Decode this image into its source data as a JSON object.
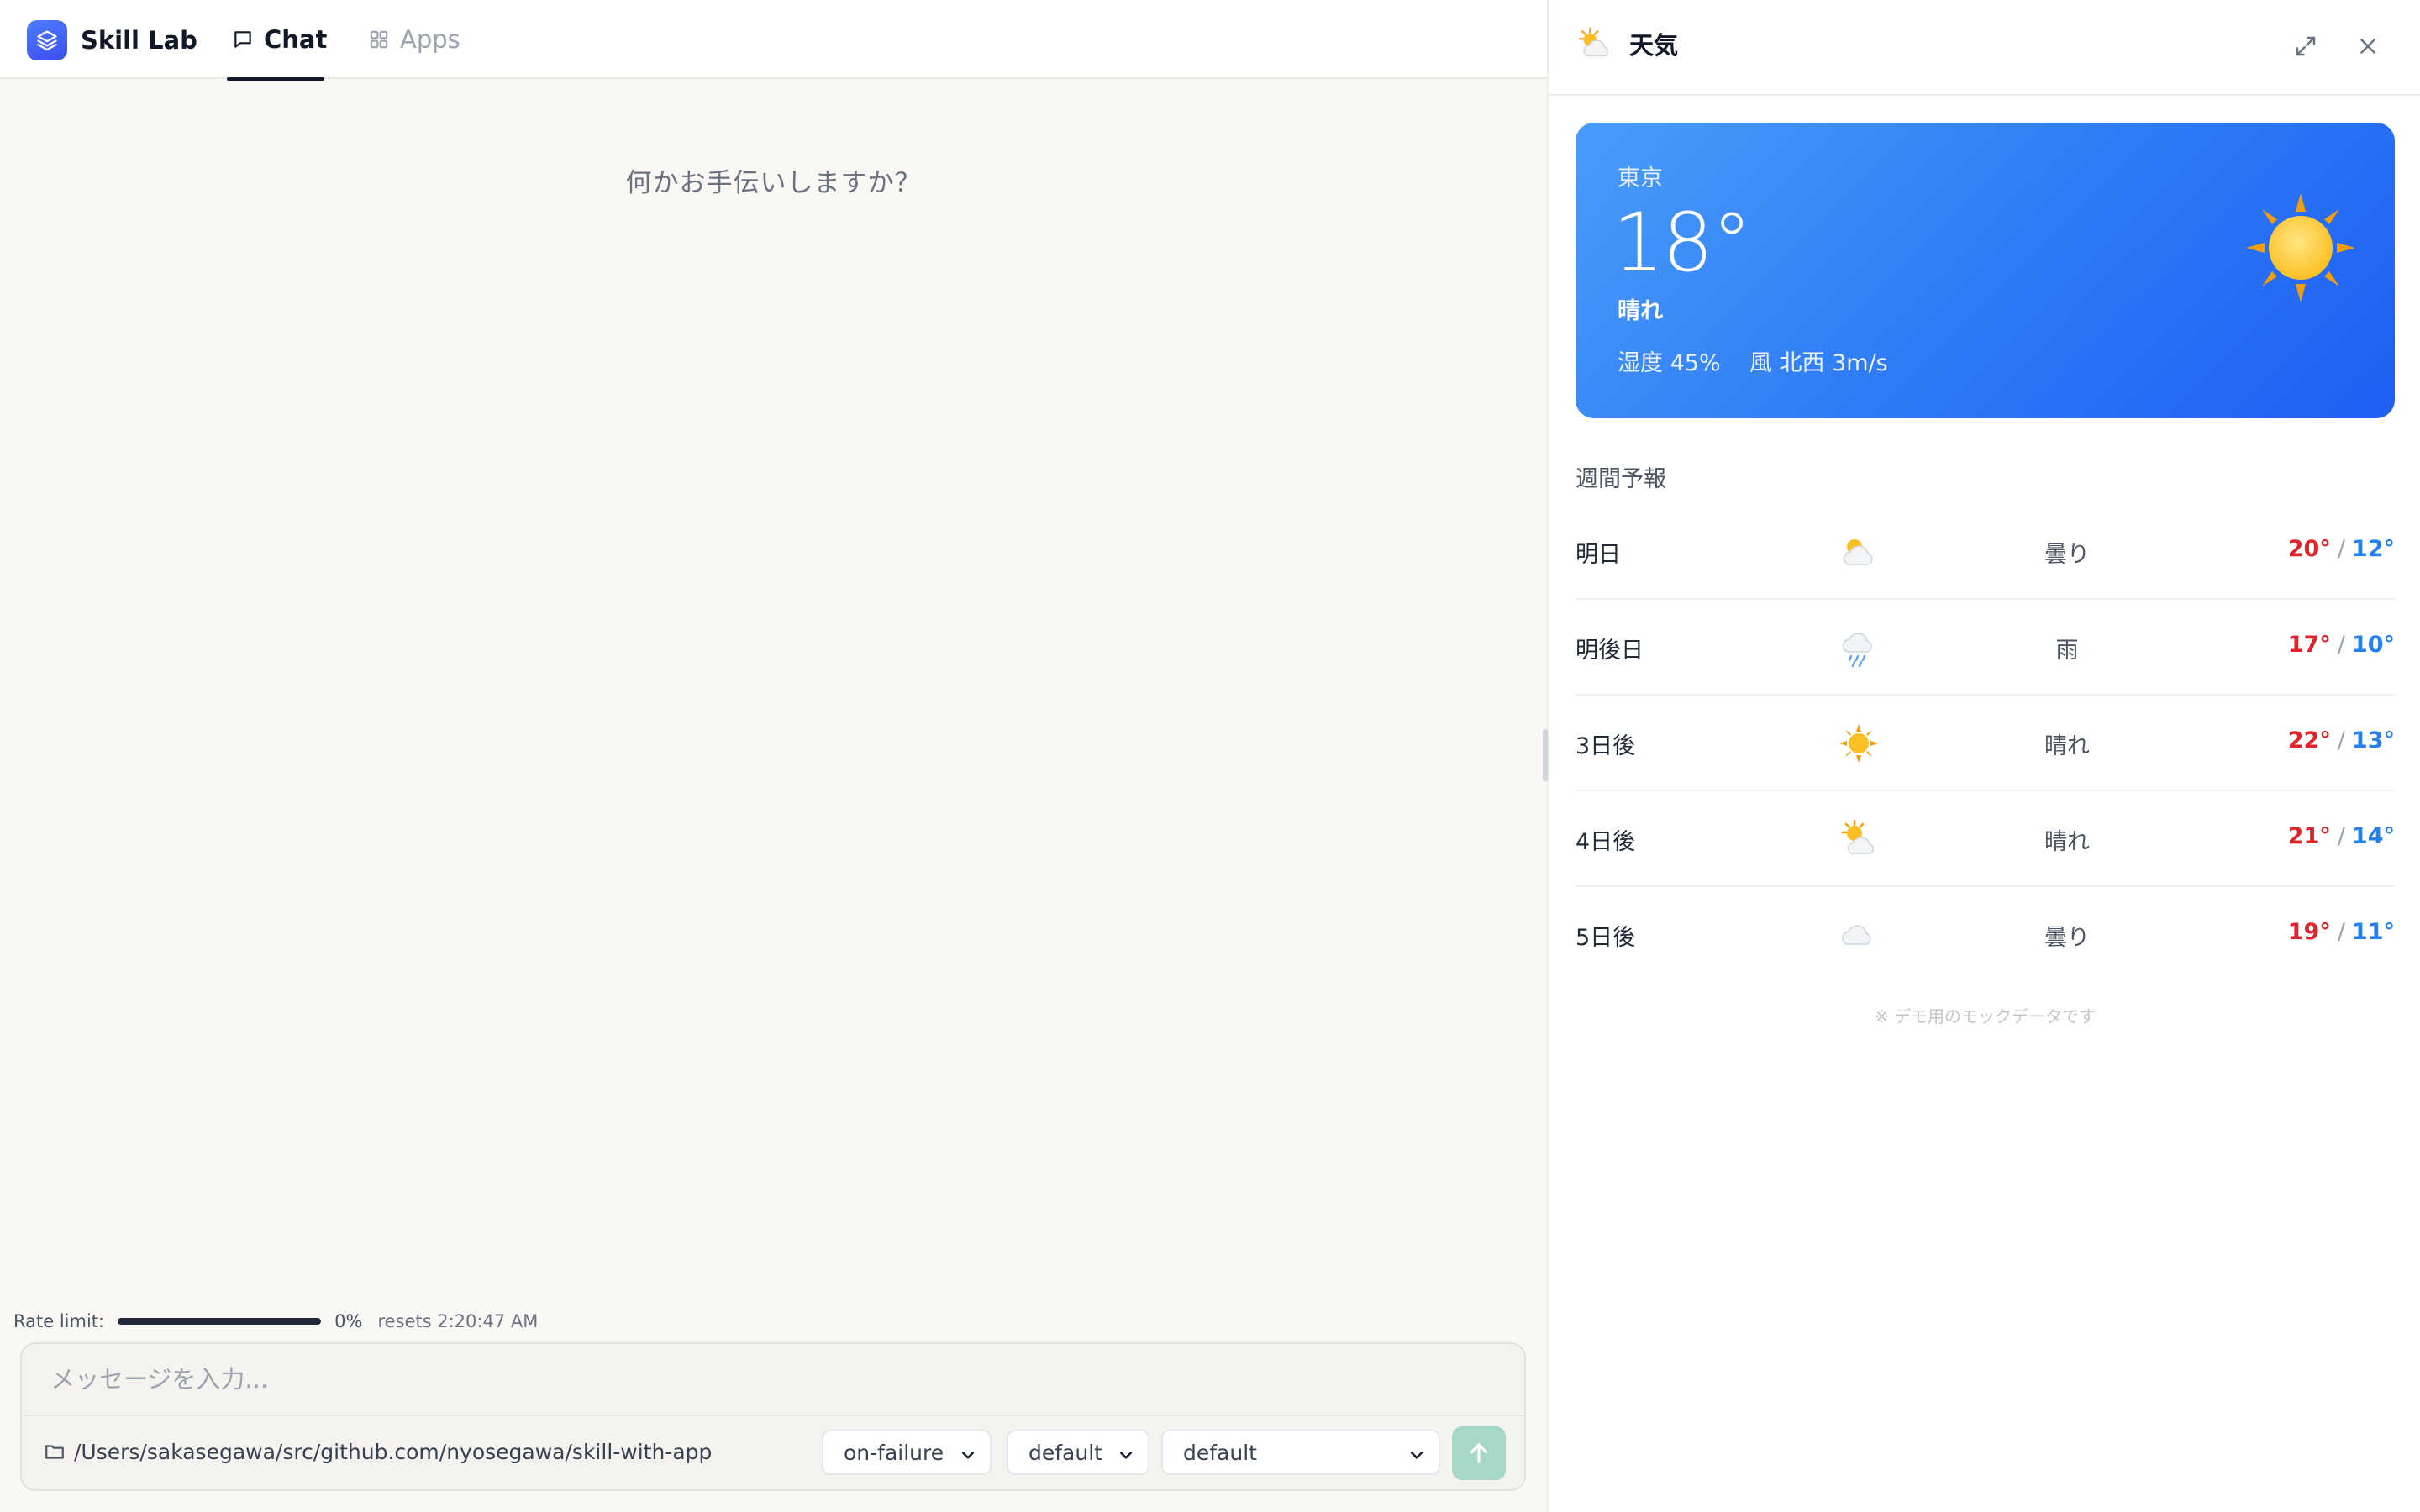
{
  "app": {
    "name": "Skill Lab",
    "tabs": [
      {
        "label": "Chat",
        "icon": "message-square-icon",
        "active": true
      },
      {
        "label": "Apps",
        "icon": "grid-icon",
        "active": false
      }
    ]
  },
  "chat": {
    "greeting": "何かお手伝いしますか？",
    "rate_limit": {
      "label": "Rate limit:",
      "percent_text": "0%",
      "fill_fraction": 1.0,
      "reset_text": "resets 2:20:47 AM"
    },
    "composer": {
      "placeholder": "メッセージを入力...",
      "value": "",
      "path": "/Users/sakasegawa/src/github.com/nyosegawa/skill-with-app",
      "selects": [
        "on-failure",
        "default",
        "default"
      ]
    }
  },
  "panel": {
    "title": "天気",
    "header_icon": "sun-behind-cloud-icon",
    "current": {
      "city": "東京",
      "temp": "18°",
      "condition": "晴れ",
      "detail": "湿度 45%    風 北西 3m/s",
      "icon": "sun-icon"
    },
    "forecast_title": "週間予報",
    "forecast": [
      {
        "day": "明日",
        "icon": "cloud-sun-icon",
        "condition": "曇り",
        "high": "20°",
        "low": "12°"
      },
      {
        "day": "明後日",
        "icon": "cloud-rain-icon",
        "condition": "雨",
        "high": "17°",
        "low": "10°"
      },
      {
        "day": "3日後",
        "icon": "sun-icon",
        "condition": "晴れ",
        "high": "22°",
        "low": "13°"
      },
      {
        "day": "4日後",
        "icon": "sun-behind-cloud-icon",
        "condition": "晴れ",
        "high": "21°",
        "low": "14°"
      },
      {
        "day": "5日後",
        "icon": "cloud-icon",
        "condition": "曇り",
        "high": "19°",
        "low": "11°"
      }
    ],
    "separator": "/",
    "note": "※ デモ用のモックデータです"
  },
  "colors": {
    "brand": "#3a4ff0",
    "card_gradient_start": "#4a9cf8",
    "card_gradient_end": "#1f5ef2",
    "high_temp": "#e0242b",
    "low_temp": "#2680eb",
    "send_button": "#a6d7c9"
  }
}
